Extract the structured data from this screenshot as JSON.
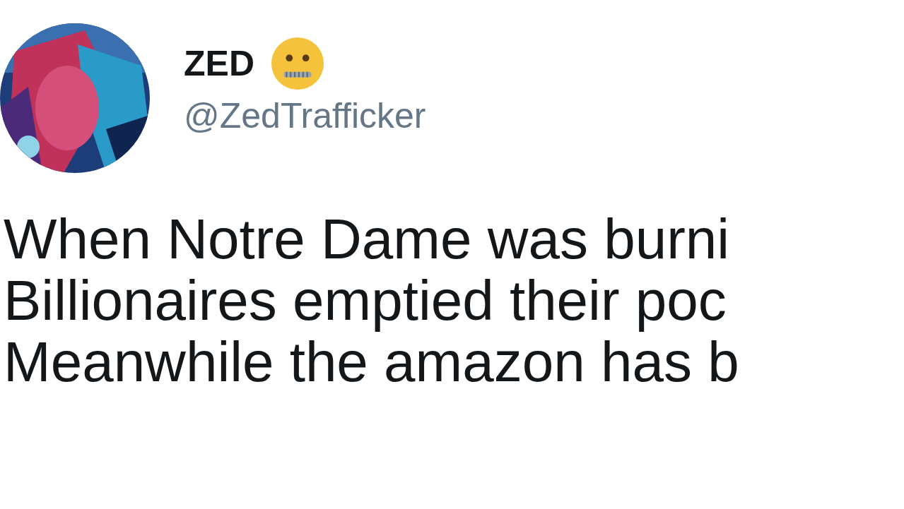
{
  "author": {
    "name": "ZED",
    "handle": "@ZedTrafficker"
  },
  "tweet": {
    "lines": [
      "When Notre Dame was burni",
      "Billionaires emptied their poc",
      "Meanwhile the amazon has b"
    ]
  }
}
